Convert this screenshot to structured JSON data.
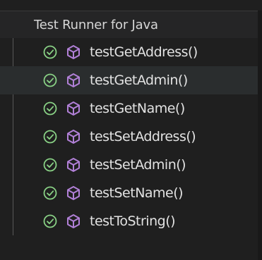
{
  "panel": {
    "title": "Test Runner for Java"
  },
  "colors": {
    "pass": "#89d185",
    "method": "#b180d7",
    "background": "#1f1f1f",
    "header_background": "#252526",
    "selected_row": "#2a2d2e"
  },
  "tests": [
    {
      "label": "testGetAddress()",
      "status": "passed",
      "status_icon": "check-circle-icon",
      "kind_icon": "method-cube-icon"
    },
    {
      "label": "testGetAdmin()",
      "status": "passed",
      "status_icon": "check-circle-icon",
      "kind_icon": "method-cube-icon",
      "selected": true
    },
    {
      "label": "testGetName()",
      "status": "passed",
      "status_icon": "check-circle-icon",
      "kind_icon": "method-cube-icon"
    },
    {
      "label": "testSetAddress()",
      "status": "passed",
      "status_icon": "check-circle-icon",
      "kind_icon": "method-cube-icon"
    },
    {
      "label": "testSetAdmin()",
      "status": "passed",
      "status_icon": "check-circle-icon",
      "kind_icon": "method-cube-icon"
    },
    {
      "label": "testSetName()",
      "status": "passed",
      "status_icon": "check-circle-icon",
      "kind_icon": "method-cube-icon"
    },
    {
      "label": "testToString()",
      "status": "passed",
      "status_icon": "check-circle-icon",
      "kind_icon": "method-cube-icon"
    }
  ]
}
